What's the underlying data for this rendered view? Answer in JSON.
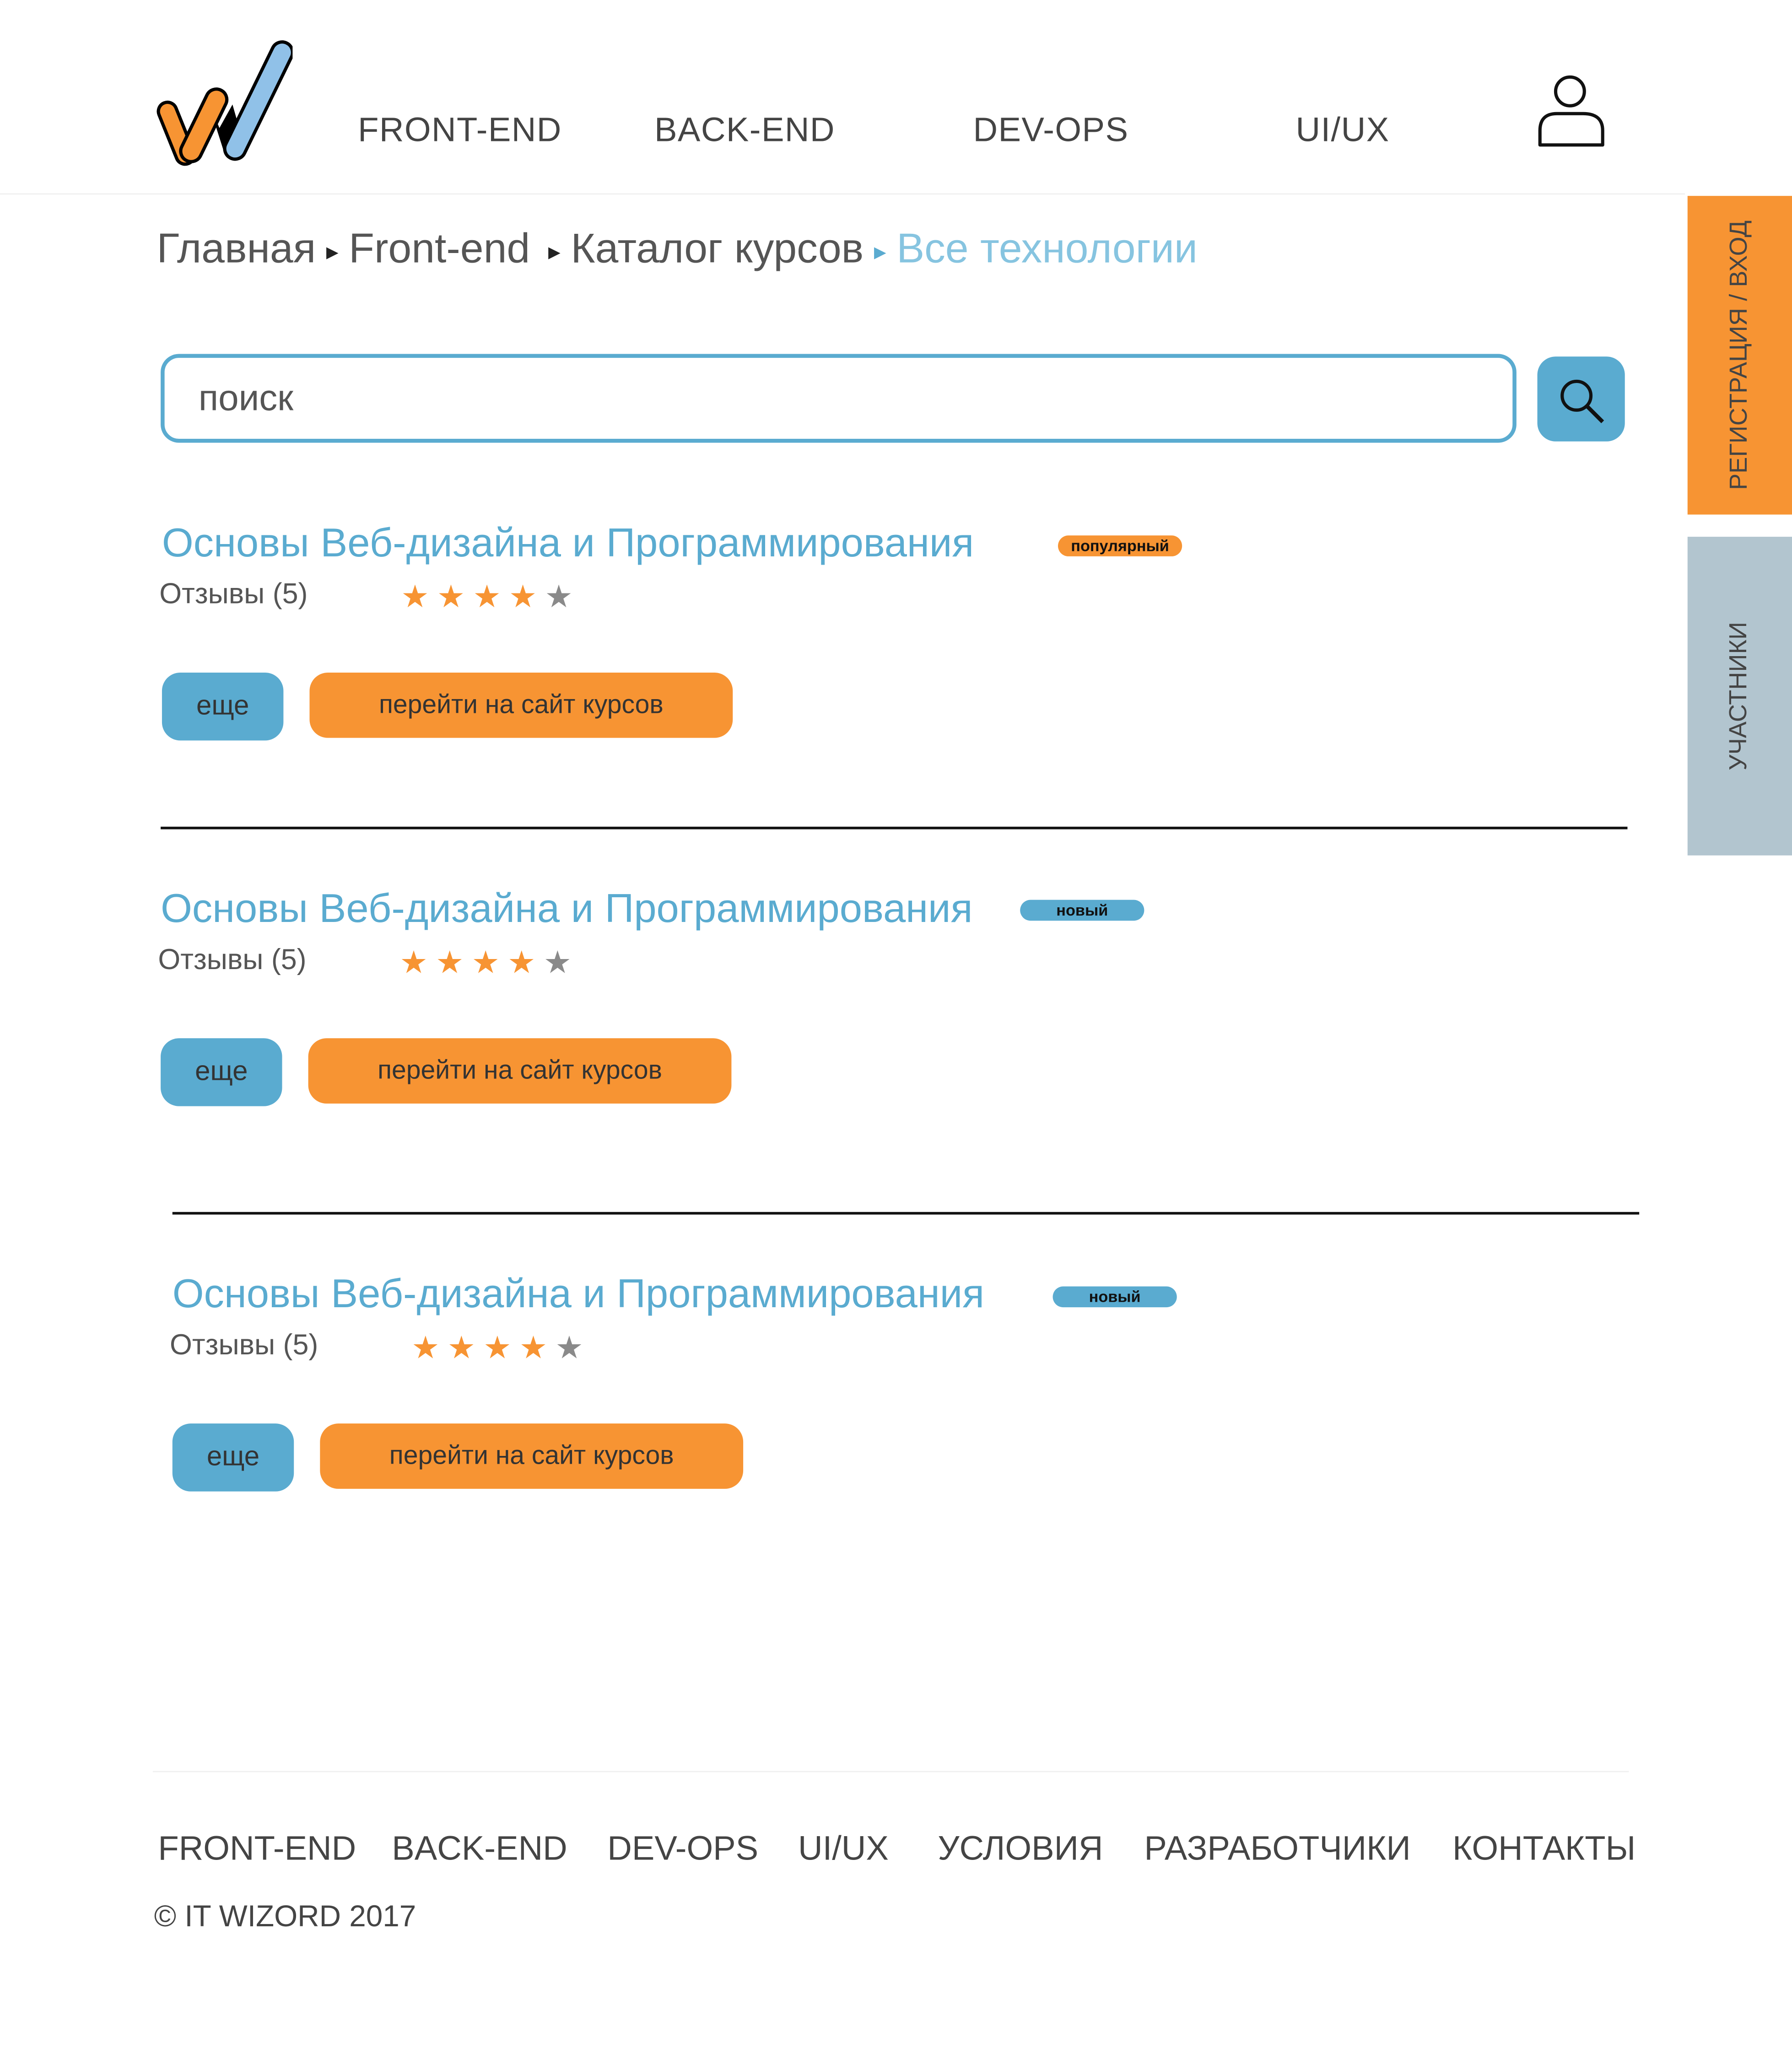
{
  "header": {
    "nav": [
      "FRONT-END",
      "BACK-END",
      "DEV-OPS",
      "UI/UX"
    ]
  },
  "breadcrumb": [
    "Главная",
    "Front-end",
    "Каталог курсов",
    "Все технологии"
  ],
  "search": {
    "placeholder": "поиск"
  },
  "side_tabs": {
    "auth": "РЕГИСТРАЦИЯ / ВХОД",
    "members": "УЧАСТНИКИ"
  },
  "colors": {
    "blue": "#5aabd0",
    "orange": "#f79433",
    "gray": "#b2c5cf"
  },
  "courses": [
    {
      "title": "Основы Веб-дизайна и Программирования",
      "badge": "популярный",
      "reviews": "Отзывы (5)",
      "rating": 4,
      "max_rating": 5,
      "more": "еще",
      "go": "перейти на сайт курсов"
    },
    {
      "title": "Основы Веб-дизайна и Программирования",
      "badge": "новый",
      "reviews": "Отзывы (5)",
      "rating": 4,
      "max_rating": 5,
      "more": "еще",
      "go": "перейти на сайт курсов"
    },
    {
      "title": "Основы Веб-дизайна и Программирования",
      "badge": "новый",
      "reviews": "Отзывы (5)",
      "rating": 4,
      "max_rating": 5,
      "more": "еще",
      "go": "перейти на сайт курсов"
    }
  ],
  "footer": {
    "links": [
      "FRONT-END",
      "BACK-END",
      "DEV-OPS",
      "UI/UX",
      "УСЛОВИЯ",
      "РАЗРАБОТЧИКИ",
      "КОНТАКТЫ"
    ],
    "copyright": "© IT WIZORD 2017"
  }
}
